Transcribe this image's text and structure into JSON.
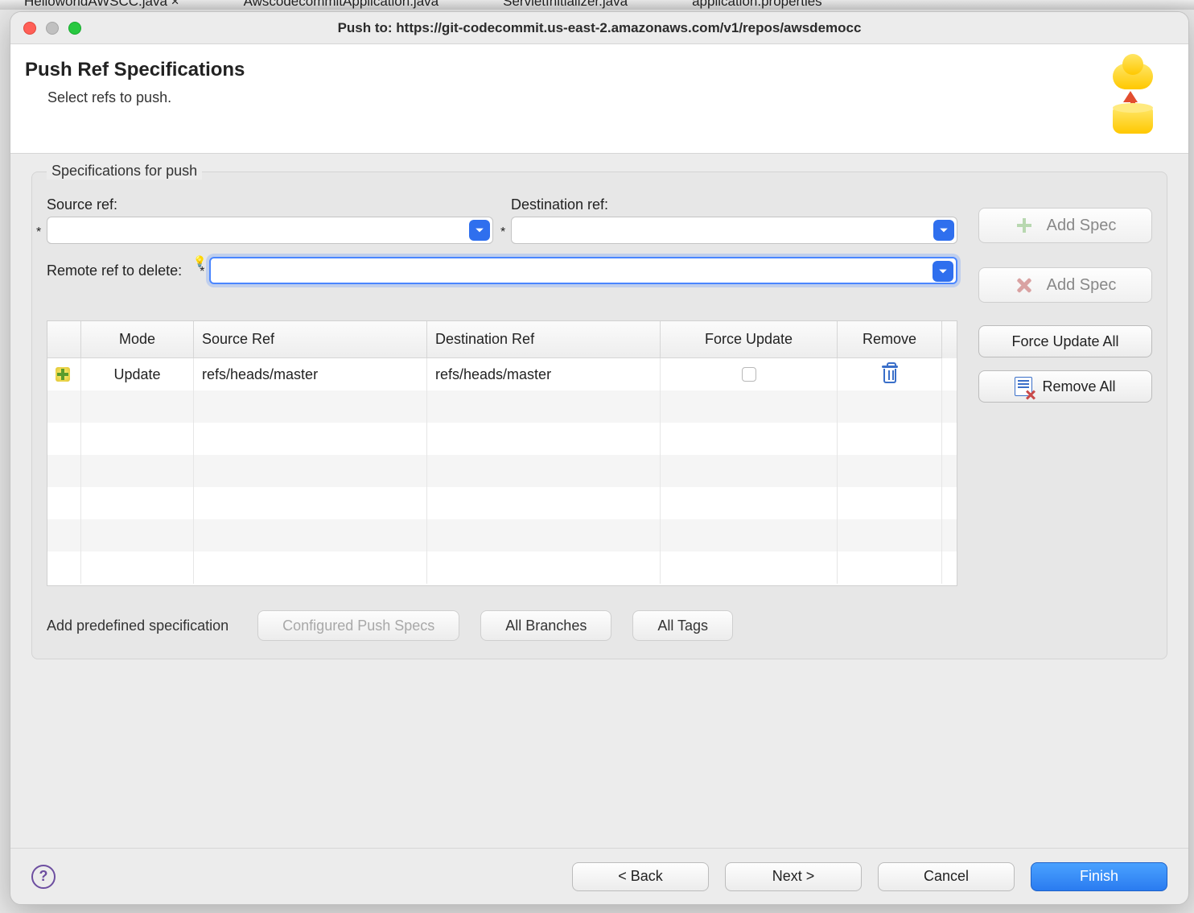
{
  "titlebar": {
    "title": "Push to: https://git-codecommit.us-east-2.amazonaws.com/v1/repos/awsdemocc"
  },
  "header": {
    "heading": "Push Ref Specifications",
    "subtext": "Select refs to push."
  },
  "group": {
    "legend": "Specifications for push",
    "source_ref_label": "Source ref:",
    "destination_ref_label": "Destination ref:",
    "remote_delete_label": "Remote ref to delete:",
    "source_ref_value": "",
    "destination_ref_value": "",
    "remote_delete_value": ""
  },
  "side": {
    "add_spec_top": "Add Spec",
    "add_spec_bottom": "Add Spec",
    "force_update_all": "Force Update All",
    "remove_all": "Remove All"
  },
  "table": {
    "headers": {
      "mode": "Mode",
      "source": "Source Ref",
      "dest": "Destination Ref",
      "force": "Force Update",
      "remove": "Remove"
    },
    "rows": [
      {
        "mode": "Update",
        "source": "refs/heads/master",
        "dest": "refs/heads/master",
        "force": false
      }
    ]
  },
  "predef": {
    "label": "Add predefined specification",
    "configured": "Configured Push Specs",
    "all_branches": "All Branches",
    "all_tags": "All Tags"
  },
  "footer": {
    "back": "< Back",
    "next": "Next >",
    "cancel": "Cancel",
    "finish": "Finish"
  }
}
